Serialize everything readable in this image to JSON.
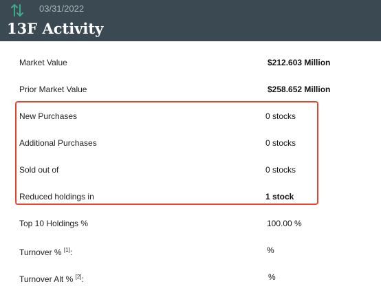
{
  "header": {
    "date": "03/31/2022",
    "title": "13F Activity",
    "icon": "up-down-arrows-icon",
    "icon_color": "#3fa98a",
    "background": "#3b4a52"
  },
  "rows": [
    {
      "label": "Market Value",
      "value": "$212.603 Million"
    },
    {
      "label": "Prior Market Value",
      "value": "$258.652 Million"
    },
    {
      "label": "New Purchases",
      "value": "0 stocks"
    },
    {
      "label": "Additional Purchases",
      "value": "0 stocks"
    },
    {
      "label": "Sold out of",
      "value": "0 stocks"
    },
    {
      "label": "Reduced holdings in",
      "value": "1 stock"
    },
    {
      "label": "Top 10 Holdings %",
      "value": "100.00 %"
    },
    {
      "label": "Turnover %",
      "footnote": "[1]",
      "suffix": ":",
      "value": "%"
    },
    {
      "label": "Turnover Alt %",
      "footnote": "[2]",
      "suffix": ":",
      "value": "%"
    }
  ],
  "highlight_color": "#e8412c"
}
